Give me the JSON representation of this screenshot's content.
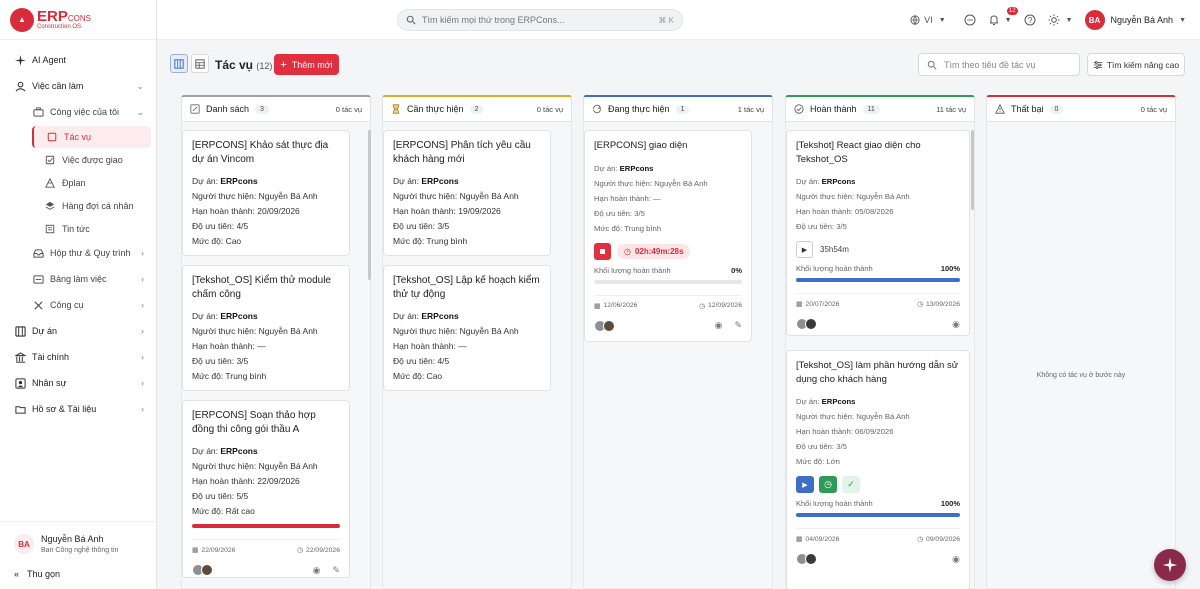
{
  "app": {
    "logo_main": "ERP",
    "logo_suffix": "CONS",
    "logo_sub": "Construction OS"
  },
  "sidebar": {
    "items": [
      {
        "label": "AI Agent",
        "icon": "sparkle-icon"
      },
      {
        "label": "Việc cần làm",
        "icon": "user-task-icon"
      },
      {
        "label": "Công việc của tôi",
        "icon": "briefcase-icon"
      },
      {
        "label": "Tác vụ",
        "icon": "task-icon"
      },
      {
        "label": "Việc được giao",
        "icon": "check-square-icon"
      },
      {
        "label": "Đplan",
        "icon": "pyramid-icon"
      },
      {
        "label": "Hàng đợi cá nhân",
        "icon": "layers-icon"
      },
      {
        "label": "Tin tức",
        "icon": "news-icon"
      },
      {
        "label": "Hộp thư & Quy trình",
        "icon": "inbox-icon"
      },
      {
        "label": "Bảng làm việc",
        "icon": "board-icon"
      },
      {
        "label": "Công cụ",
        "icon": "tools-icon"
      },
      {
        "label": "Dự án",
        "icon": "project-icon"
      },
      {
        "label": "Tài chính",
        "icon": "finance-icon"
      },
      {
        "label": "Nhân sự",
        "icon": "person-icon"
      },
      {
        "label": "Hồ sơ & Tài liệu",
        "icon": "folder-icon"
      }
    ],
    "user": {
      "initials": "BA",
      "name": "Nguyễn Bá Anh",
      "dept": "Ban Công nghệ thông tin"
    },
    "collapse_label": "Thu gọn"
  },
  "topbar": {
    "search_placeholder": "Tìm kiếm mọi thứ trong ERPCons...",
    "search_shortcut": "⌘ K",
    "language": "VI",
    "notifications_count": "12",
    "user_initials": "BA",
    "user_name": "Nguyễn Bá Anh"
  },
  "toolbar": {
    "title": "Tác vụ",
    "count": "(12)",
    "add_label": "Thêm mới",
    "filter_placeholder": "Tìm theo tiêu đề tác vụ",
    "advanced_label": "Tìm kiếm nâng cao"
  },
  "columns": [
    {
      "title": "Danh sách",
      "count": "3",
      "total": "0 tác vụ",
      "color": "#9aa0a6",
      "icon": "list-edit-icon"
    },
    {
      "title": "Cần thực hiện",
      "count": "2",
      "total": "0 tác vụ",
      "color": "#e3a92a",
      "icon": "hourglass-icon"
    },
    {
      "title": "Đang thực hiện",
      "count": "1",
      "total": "1 tác vụ",
      "color": "#3f6fc4",
      "icon": "refresh-icon"
    },
    {
      "title": "Hoàn thành",
      "count": "11",
      "total": "11 tác vụ",
      "color": "#2e9b56",
      "icon": "check-circle-icon"
    },
    {
      "title": "Thất bại",
      "count": "0",
      "total": "0 tác vụ",
      "color": "#d82c3a",
      "icon": "warning-icon",
      "empty_text": "Không có tác vụ ở bước này"
    }
  ],
  "labels": {
    "project": "Dự án: ",
    "assignee": "Người thực hiện: ",
    "due": "Hạn hoàn thành: ",
    "priority": "Độ ưu tiên: ",
    "level": "Mức độ: ",
    "progress": "Khối lượng hoàn thành"
  },
  "cards": {
    "c1": {
      "title": "[ERPCONS] Khảo sát thực địa dự án Vincom",
      "project": "ERPcons",
      "assignee": "Nguyễn Bá Anh",
      "due": "20/09/2026",
      "priority": "4/5",
      "level": "Cao"
    },
    "c2": {
      "title": "[Tekshot_OS] Kiểm thử module chấm công",
      "project": "ERPcons",
      "assignee": "Nguyễn Bá Anh",
      "due": "—",
      "priority": "3/5",
      "level": "Trung bình"
    },
    "c3": {
      "title": "[ERPCONS] Soạn thảo hợp đồng thi công gói thầu A",
      "project": "ERPcons",
      "assignee": "Nguyễn Bá Anh",
      "due": "22/09/2026",
      "priority": "5/5",
      "level": "Rất cao",
      "start": "22/09/2026",
      "end": "22/09/2026",
      "progress": 1.0
    },
    "c4": {
      "title": "[ERPCONS] Phân tích yêu cầu khách hàng mới",
      "project": "ERPcons",
      "assignee": "Nguyễn Bá Anh",
      "due": "19/09/2026",
      "priority": "3/5",
      "level": "Trung bình"
    },
    "c5": {
      "title": "[Tekshot_OS] Lập kế hoạch kiểm thử tự động",
      "project": "ERPcons",
      "assignee": "Nguyễn Bá Anh",
      "due": "—",
      "priority": "4/5",
      "level": "Cao"
    },
    "c6": {
      "title": "[ERPCONS] giao diện",
      "project": "ERPcons",
      "assignee": "Nguyễn Bá Anh",
      "due": "—",
      "priority": "3/5",
      "level": "Trung bình",
      "timer": "02h:49m:28s",
      "progress_text": "0%",
      "progress": 0,
      "start": "12/06/2026",
      "end": "12/09/2026"
    },
    "c7": {
      "title": "[Tekshot] React giao diện cho Tekshot_OS",
      "project": "ERPcons",
      "assignee": "Nguyễn Bá Anh",
      "due": "05/08/2026",
      "priority": "3/5",
      "duration": "35h54m",
      "progress_text": "100%",
      "progress": 1.0,
      "start": "20/07/2026",
      "end": "13/09/2026"
    },
    "c8": {
      "title": "[Tekshot_OS] làm phần hướng dẫn sử dụng cho khách hàng",
      "project": "ERPcons",
      "assignee": "Nguyễn Bá Anh",
      "due": "06/09/2026",
      "priority": "3/5",
      "level": "Lớn",
      "progress_text": "100%",
      "progress": 1.0,
      "start": "04/09/2026",
      "end": "09/09/2026"
    }
  }
}
